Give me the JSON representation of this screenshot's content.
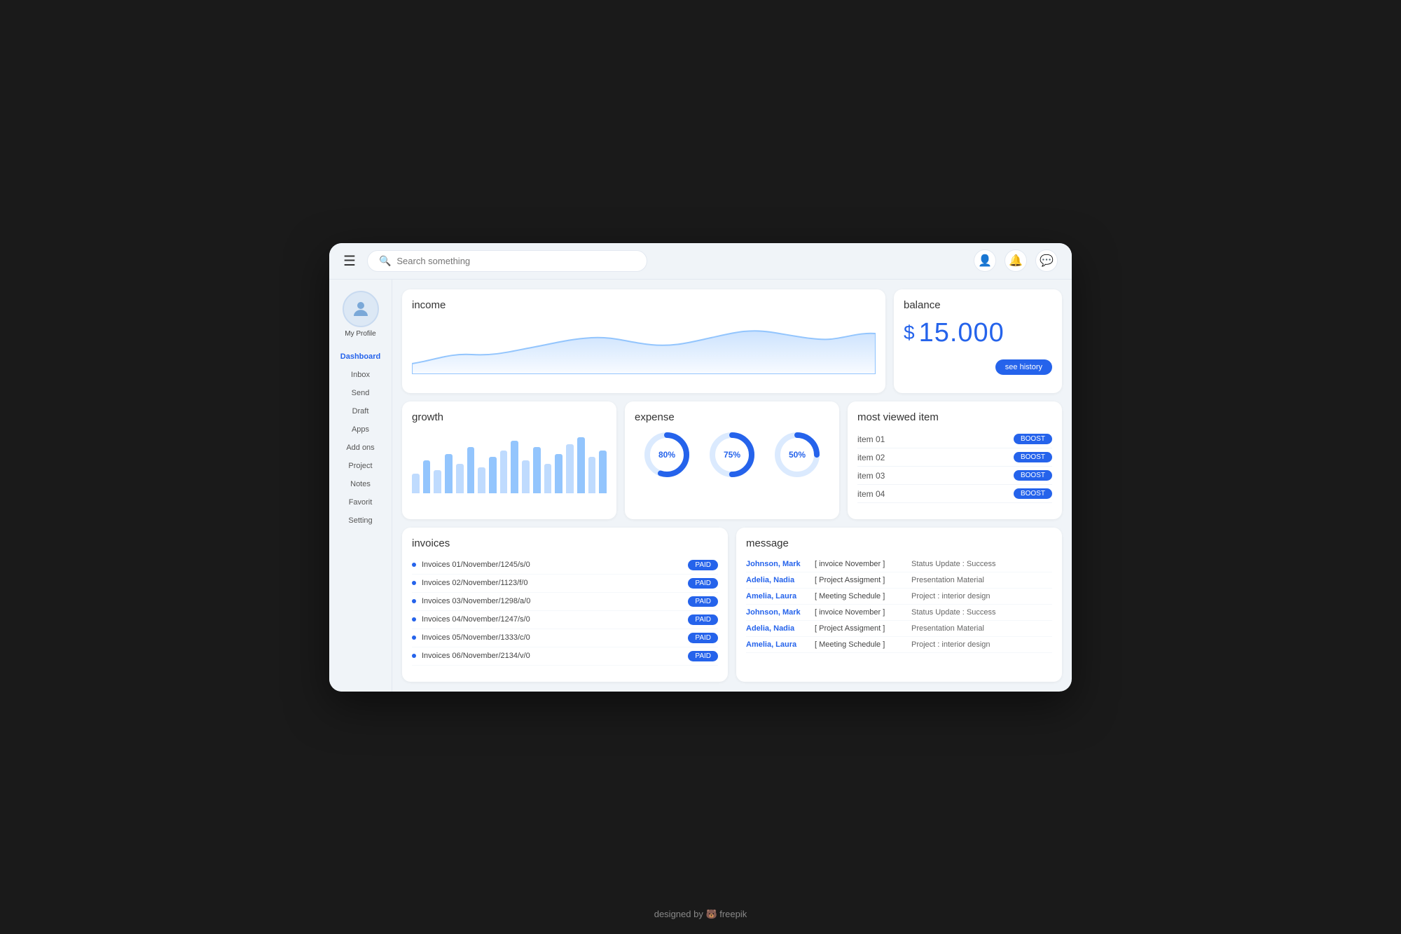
{
  "topbar": {
    "menu_label": "☰",
    "search_placeholder": "Search something"
  },
  "sidebar": {
    "profile_name": "My Profile",
    "nav_items": [
      {
        "label": "Dashboard",
        "active": true
      },
      {
        "label": "Inbox"
      },
      {
        "label": "Send"
      },
      {
        "label": "Draft"
      },
      {
        "label": "Apps"
      },
      {
        "label": "Add ons"
      },
      {
        "label": "Project"
      },
      {
        "label": "Notes"
      },
      {
        "label": "Favorit"
      },
      {
        "label": "Setting"
      }
    ]
  },
  "income": {
    "title": "income"
  },
  "balance": {
    "title": "balance",
    "dollar": "$",
    "amount": "15.000",
    "history_btn": "see history"
  },
  "growth": {
    "title": "growth",
    "bars": [
      30,
      50,
      35,
      60,
      45,
      70,
      40,
      55,
      65,
      80,
      50,
      70,
      45,
      60,
      75,
      85,
      55,
      65
    ]
  },
  "expense": {
    "title": "expense",
    "charts": [
      {
        "pct": 80,
        "label": "80%"
      },
      {
        "pct": 75,
        "label": "75%"
      },
      {
        "pct": 50,
        "label": "50%"
      }
    ]
  },
  "most_viewed": {
    "title": "most viewed item",
    "items": [
      {
        "label": "item 01",
        "btn": "BOOST"
      },
      {
        "label": "item 02",
        "btn": "BOOST"
      },
      {
        "label": "item 03",
        "btn": "BOOST"
      },
      {
        "label": "item 04",
        "btn": "BOOST"
      }
    ]
  },
  "invoices": {
    "title": "invoices",
    "rows": [
      {
        "text": "Invoices 01/November/1245/s/0",
        "status": "PAID"
      },
      {
        "text": "Invoices 02/November/1123/f/0",
        "status": "PAID"
      },
      {
        "text": "Invoices 03/November/1298/a/0",
        "status": "PAID"
      },
      {
        "text": "Invoices 04/November/1247/s/0",
        "status": "PAID"
      },
      {
        "text": "Invoices 05/November/1333/c/0",
        "status": "PAID"
      },
      {
        "text": "Invoices 06/November/2134/v/0",
        "status": "PAID"
      }
    ]
  },
  "messages": {
    "title": "message",
    "rows": [
      {
        "sender": "Johnson, Mark",
        "subject": "[ invoice November ]",
        "preview": "Status Update : Success"
      },
      {
        "sender": "Adelia, Nadia",
        "subject": "[ Project Assigment ]",
        "preview": "Presentation Material"
      },
      {
        "sender": "Amelia, Laura",
        "subject": "[ Meeting Schedule ]",
        "preview": "Project : interior design"
      },
      {
        "sender": "Johnson, Mark",
        "subject": "[ invoice November ]",
        "preview": "Status Update : Success"
      },
      {
        "sender": "Adelia, Nadia",
        "subject": "[ Project Assigment ]",
        "preview": "Presentation Material"
      },
      {
        "sender": "Amelia, Laura",
        "subject": "[ Meeting Schedule ]",
        "preview": "Project : interior design"
      }
    ]
  },
  "footer": {
    "text": "designed by 🐻 freepik"
  },
  "colors": {
    "blue": "#2563eb",
    "light_blue": "#bfdbfe",
    "bg": "#f0f4f8"
  }
}
